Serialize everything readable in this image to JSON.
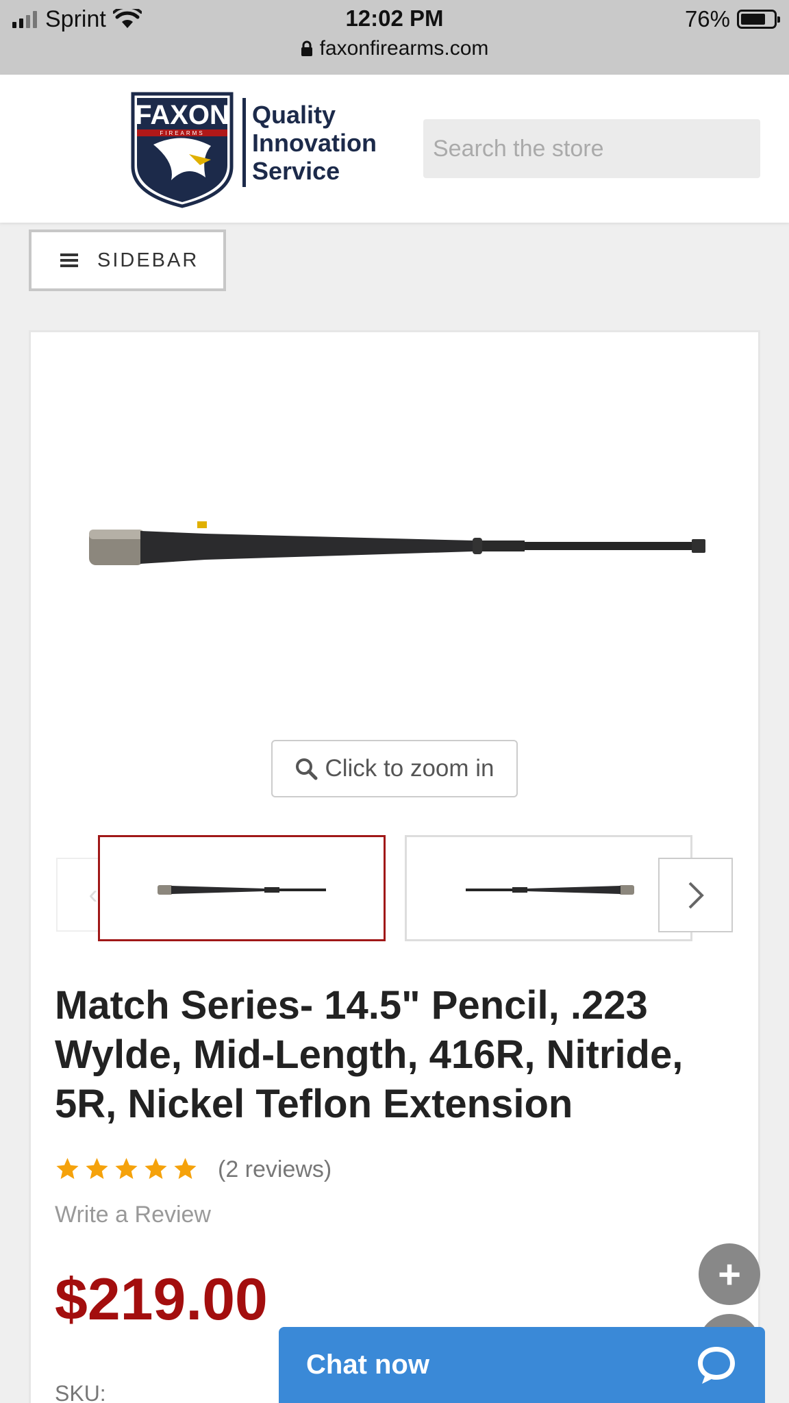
{
  "status_bar": {
    "carrier": "Sprint",
    "time": "12:02 PM",
    "battery_percent": "76%",
    "battery_level": 0.76,
    "signal_bars": 2,
    "url": "faxonfirearms.com",
    "icons": [
      "signal-icon",
      "wifi-icon",
      "battery-icon",
      "lock-icon"
    ]
  },
  "header": {
    "logo_text": "FAXON",
    "logo_subtext": "FIREARMS",
    "tagline_1": "Quality",
    "tagline_2": "Innovation",
    "tagline_3": "Service",
    "search_placeholder": "Search the store"
  },
  "sidebar_button": {
    "label": "SIDEBAR",
    "icon": "menu-icon"
  },
  "product": {
    "zoom_label": "Click to zoom in",
    "title": "Match Series- 14.5\" Pencil, .223 Wylde, Mid-Length, 416R, Nitride, 5R, Nickel Teflon Extension",
    "rating": 5,
    "rating_max": 5,
    "reviews": "(2 reviews)",
    "write_review": "Write a Review",
    "price": "$219.00",
    "sku_label": "SKU:"
  },
  "chat": {
    "label": "Chat now",
    "icon": "chat-bubble-icon"
  },
  "colors": {
    "accent_red": "#a30e0e",
    "chat_blue": "#3a89d7",
    "star_orange": "#f5a20b"
  }
}
